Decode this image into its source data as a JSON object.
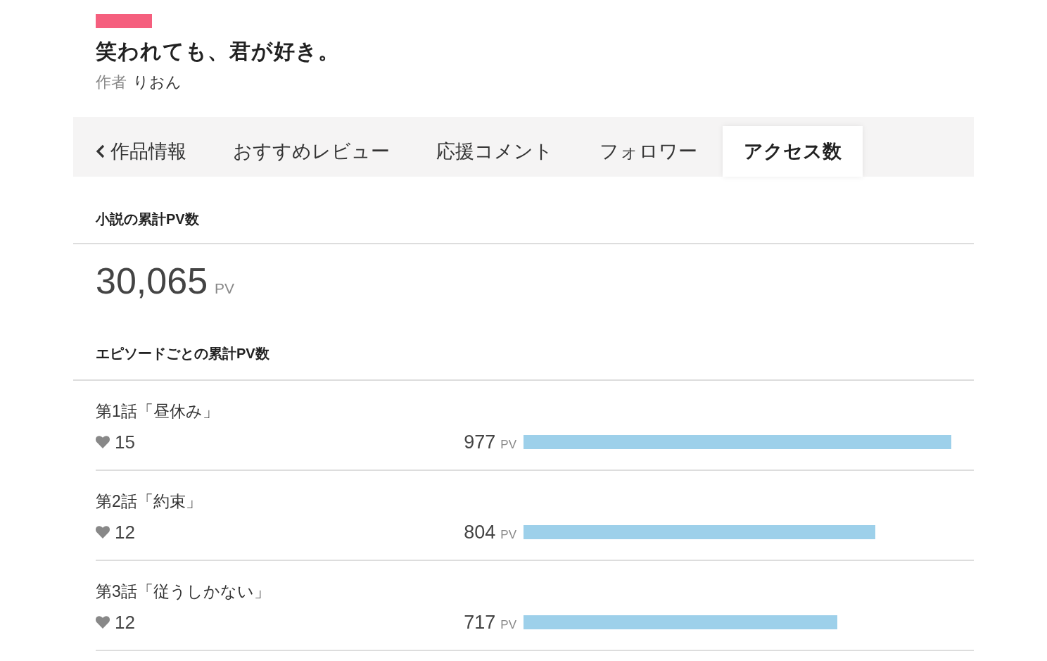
{
  "work": {
    "title": "笑われても、君が好き。",
    "author_label": "作者",
    "author": "りおん"
  },
  "tabs": [
    {
      "label": "作品情報",
      "kind": "back",
      "selected": false
    },
    {
      "label": "おすすめレビュー",
      "kind": "tab",
      "selected": false
    },
    {
      "label": "応援コメント",
      "kind": "tab",
      "selected": false
    },
    {
      "label": "フォロワー",
      "kind": "tab",
      "selected": false
    },
    {
      "label": "アクセス数",
      "kind": "tab",
      "selected": true
    }
  ],
  "total": {
    "heading": "小説の累計PV数",
    "value": "30,065",
    "unit": "PV"
  },
  "episodes": {
    "heading": "エピソードごとの累計PV数",
    "items": [
      {
        "title": "第1話「昼休み」",
        "likes": "15",
        "pv": "977",
        "unit": "PV",
        "level": 1.0
      },
      {
        "title": "第2話「約束」",
        "likes": "12",
        "pv": "804",
        "unit": "PV",
        "level": 0.822
      },
      {
        "title": "第3話「従うしかない」",
        "likes": "12",
        "pv": "717",
        "unit": "PV",
        "level": 0.734
      }
    ]
  }
}
